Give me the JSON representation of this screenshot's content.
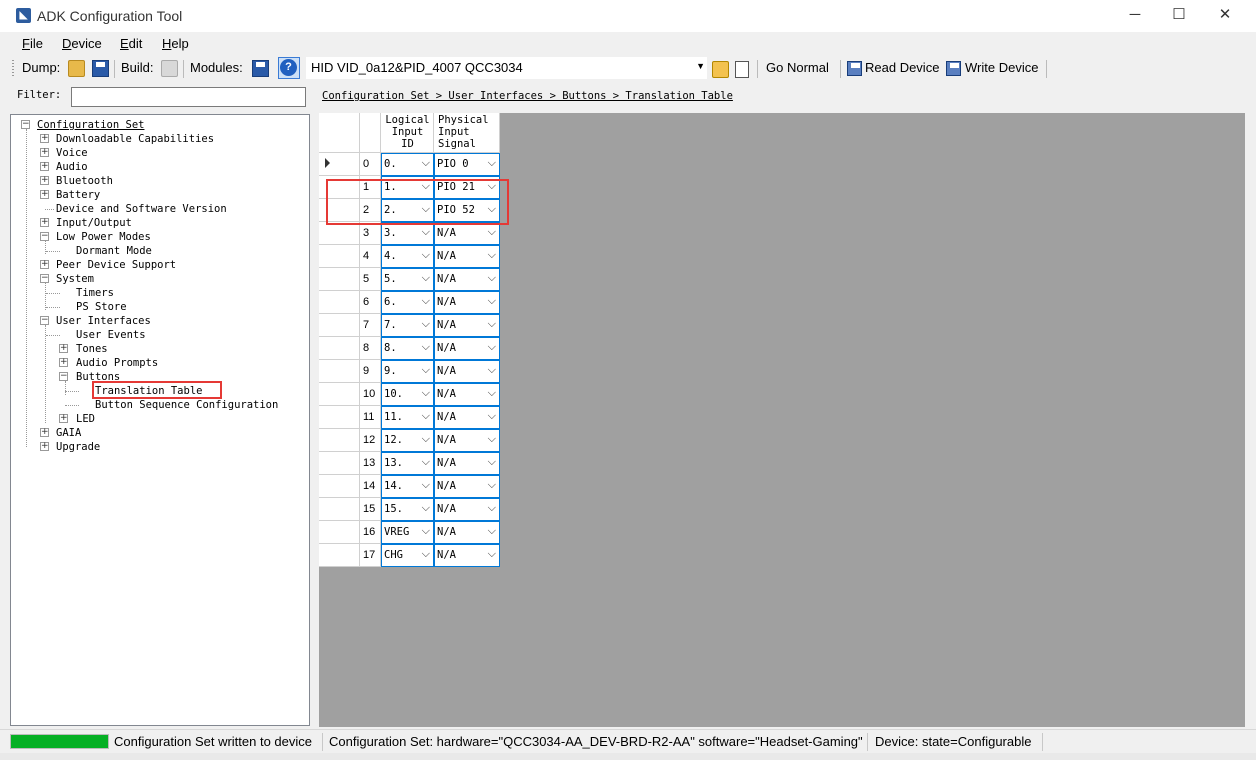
{
  "window": {
    "title": "ADK Configuration Tool",
    "minimize": "─",
    "maximize": "☐",
    "close": "✕"
  },
  "menu": [
    {
      "accel": "F",
      "rest": "ile"
    },
    {
      "accel": "D",
      "rest": "evice"
    },
    {
      "accel": "E",
      "rest": "dit"
    },
    {
      "accel": "H",
      "rest": "elp"
    }
  ],
  "toolbar": {
    "dump_label": "Dump:",
    "build_label": "Build:",
    "modules_label": "Modules:",
    "device_value": "HID VID_0a12&PID_4007 QCC3034",
    "go_normal": "Go Normal",
    "read_device": "Read Device",
    "write_device": "Write Device"
  },
  "filter": {
    "label": "Filter:",
    "value": ""
  },
  "breadcrumb": "Configuration Set > User Interfaces > Buttons > Translation Table",
  "tree": {
    "root": "Configuration Set",
    "items": [
      "Downloadable Capabilities",
      "Voice",
      "Audio",
      "Bluetooth",
      "Battery",
      "Device and Software Version",
      "Input/Output",
      "Low Power Modes",
      "Dormant Mode",
      "Peer Device Support",
      "System",
      "Timers",
      "PS Store",
      "User Interfaces",
      "User Events",
      "Tones",
      "Audio Prompts",
      "Buttons",
      "Translation Table",
      "Button Sequence Configuration",
      "LED",
      "GAIA",
      "Upgrade"
    ]
  },
  "grid": {
    "col1_header": [
      "Logical",
      "Input",
      "ID"
    ],
    "col2_header": [
      "Physical",
      "Input",
      "Signal"
    ],
    "rows": [
      {
        "index": "0",
        "logical": "0.",
        "physical": "PIO 0"
      },
      {
        "index": "1",
        "logical": "1.",
        "physical": "PIO 21"
      },
      {
        "index": "2",
        "logical": "2.",
        "physical": "PIO 52"
      },
      {
        "index": "3",
        "logical": "3.",
        "physical": "N/A"
      },
      {
        "index": "4",
        "logical": "4.",
        "physical": "N/A"
      },
      {
        "index": "5",
        "logical": "5.",
        "physical": "N/A"
      },
      {
        "index": "6",
        "logical": "6.",
        "physical": "N/A"
      },
      {
        "index": "7",
        "logical": "7.",
        "physical": "N/A"
      },
      {
        "index": "8",
        "logical": "8.",
        "physical": "N/A"
      },
      {
        "index": "9",
        "logical": "9.",
        "physical": "N/A"
      },
      {
        "index": "10",
        "logical": "10.",
        "physical": "N/A"
      },
      {
        "index": "11",
        "logical": "11.",
        "physical": "N/A"
      },
      {
        "index": "12",
        "logical": "12.",
        "physical": "N/A"
      },
      {
        "index": "13",
        "logical": "13.",
        "physical": "N/A"
      },
      {
        "index": "14",
        "logical": "14.",
        "physical": "N/A"
      },
      {
        "index": "15",
        "logical": "15.",
        "physical": "N/A"
      },
      {
        "index": "16",
        "logical": "VREG",
        "physical": "N/A"
      },
      {
        "index": "17",
        "logical": "CHG",
        "physical": "N/A"
      }
    ]
  },
  "status": {
    "progress_fraction": 1.0,
    "message": "Configuration Set written to device",
    "config": "Configuration Set:  hardware=\"QCC3034-AA_DEV-BRD-R2-AA\" software=\"Headset-Gaming\"",
    "device": "Device:  state=Configurable"
  },
  "colors": {
    "highlight": "#e53935",
    "progress": "#06b025",
    "focus": "#0078d7"
  },
  "icons": {
    "app": "adk-app-icon",
    "open": "open-folder-icon",
    "save": "save-floppy-icon",
    "help": "help-icon",
    "lock": "lock-icon",
    "chip": "chip-icon",
    "read": "read-device-icon",
    "write": "write-device-icon"
  }
}
